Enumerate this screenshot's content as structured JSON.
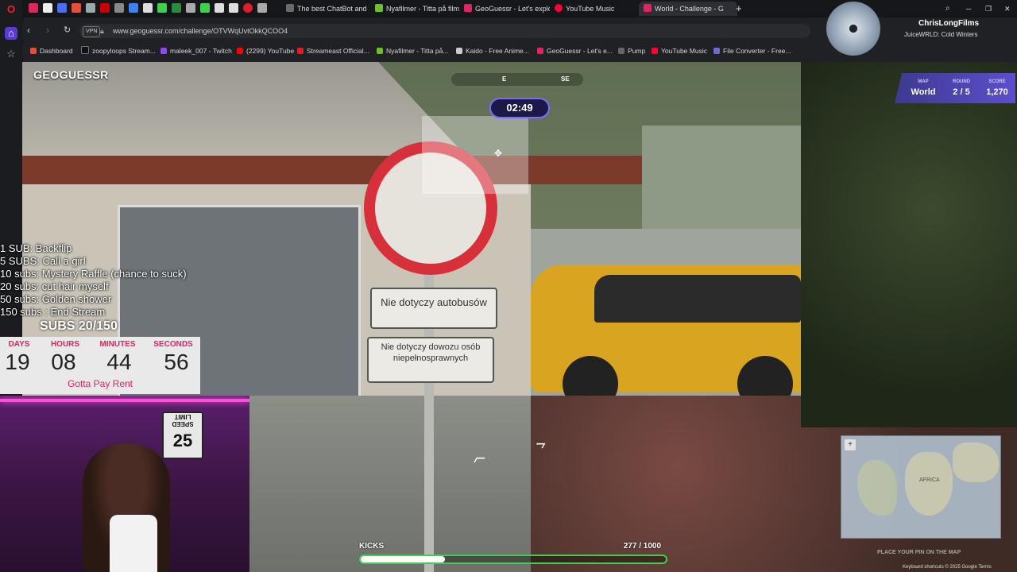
{
  "browser": {
    "tabs": [
      {
        "label": "The best ChatBot and",
        "color": "#6b6b6b"
      },
      {
        "label": "Nyafilmer - Titta på filmer",
        "color": "#6bbf27"
      },
      {
        "label": "GeoGuessr - Let's explore",
        "color": "#e0245e"
      },
      {
        "label": "YouTube Music",
        "color": "#ff0033"
      },
      {
        "label": "World - Challenge - G",
        "color": "#e0245e",
        "active": true
      }
    ],
    "new_tab": "+",
    "vpn": "VPN",
    "url": "www.geoguessr.com/challenge/OTVWqUvtOkkQCOO4",
    "bookmarks": [
      {
        "label": "Dashboard",
        "color": "#e74c3c"
      },
      {
        "label": "zoopyloops Stream...",
        "color": "#111111"
      },
      {
        "label": "maleek_007 - Twitch",
        "color": "#9146ff"
      },
      {
        "label": "(2299) YouTube",
        "color": "#ff0000"
      },
      {
        "label": "Streameast Official...",
        "color": "#e11d2a"
      },
      {
        "label": "Nyafilmer - Titta på...",
        "color": "#6bbf27"
      },
      {
        "label": "Kaido - Free Anime...",
        "color": "#cccccc"
      },
      {
        "label": "GeoGuessr - Let's e...",
        "color": "#e0245e"
      },
      {
        "label": "Pump",
        "color": "#666666"
      },
      {
        "label": "YouTube Music",
        "color": "#ff0033"
      },
      {
        "label": "File Converter - Free...",
        "color": "#6b6bd6"
      }
    ]
  },
  "streamer": {
    "name": "ChrisLongFilms",
    "now_playing": "JuiceWRLD: Cold Winters"
  },
  "game": {
    "logo": "GEOGUESSR",
    "timer": "02:49",
    "compass": {
      "east": "E",
      "southeast": "SE"
    },
    "map_label": "MAP",
    "map_value": "World",
    "round_label": "ROUND",
    "round_value": "2 / 5",
    "score_label": "SCORE",
    "score_value": "1,270",
    "sign_top": "Nie dotyczy autobusów",
    "sign_bottom": "Nie dotyczy dowozu osób niepełnosprawnych",
    "minimap_label": "AFRICA",
    "minimap_hint": "PLACE YOUR PIN ON THE MAP",
    "footer": "Keyboard shortcuts  © 2025 Google  Terms"
  },
  "overlay": {
    "goals": [
      "1 SUB: Backflip",
      "5 SUBS: Call a girl",
      "10 subs: Mystery Raffle (chance to suck)",
      "20 subs: cut hair myself",
      "50 subs: Golden shower",
      "150 subs : End Stream"
    ],
    "subs_counter": "SUBS 20/150",
    "countdown": [
      {
        "label": "DAYS",
        "value": "19"
      },
      {
        "label": "HOURS",
        "value": "08"
      },
      {
        "label": "MINUTES",
        "value": "44"
      },
      {
        "label": "SECONDS",
        "value": "56"
      }
    ],
    "countdown_note": "Gotta Pay Rent",
    "kicks_label": "KICKS",
    "kicks_count": "277 / 1000",
    "kicks_progress": 0.277,
    "speed_sign": {
      "top": "SPEED LIMIT",
      "value": "25"
    }
  },
  "colors": {
    "accent": "#5b4fcf",
    "kicks_border": "#3ed04a",
    "countdown_label": "#e0245e"
  }
}
